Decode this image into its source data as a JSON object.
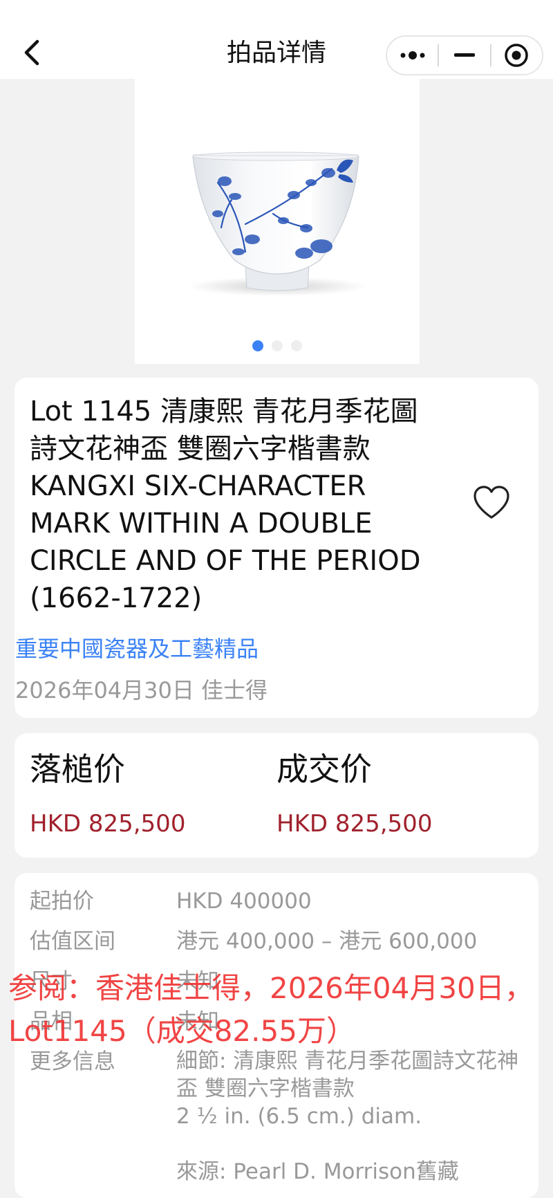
{
  "header": {
    "title": "拍品详情"
  },
  "carousel": {
    "dot_count": 3,
    "active_index": 0
  },
  "lot": {
    "title": "Lot 1145 清康熙 青花月季花圖詩文花神盃 雙圈六字楷書款 KANGXI SIX-CHARACTER MARK WITHIN A DOUBLE CIRCLE AND OF THE PERIOD (1662-1722)",
    "sale_name": "重要中國瓷器及工藝精品",
    "sale_date": "2026年04月30日 佳士得"
  },
  "prices": {
    "hammer_label": "落槌价",
    "hammer_value": "HKD 825,500",
    "deal_label": "成交价",
    "deal_value": "HKD 825,500"
  },
  "info": {
    "start_label": "起拍价",
    "start_value": "HKD 400000",
    "estimate_label": "估值区间",
    "estimate_value": "港元 400,000 – 港元 600,000",
    "size_label": "尺寸",
    "size_value": "未知",
    "condition_label": "品相",
    "condition_value": "未知",
    "more_label": "更多信息",
    "more_value": "細節: 清康熙 青花月季花圖詩文花神盃 雙圈六字楷書款\n2 ½ in. (6.5 cm.) diam.\n\n來源: Pearl D. Morrison舊藏"
  },
  "watermark": {
    "text": "参阅：香港佳士得，2026年04月30日，Lot1145（成交82.55万）"
  },
  "colors": {
    "accent_blue": "#3b82f6",
    "price_red": "#a0212c",
    "watermark_red": "#f03434",
    "cobalt": "#2a56b8"
  },
  "icons": {
    "back": "chevron-left-icon",
    "more": "more-dots-icon",
    "minimize": "minimize-icon",
    "close": "target-circle-icon",
    "favorite": "heart-outline-icon"
  }
}
